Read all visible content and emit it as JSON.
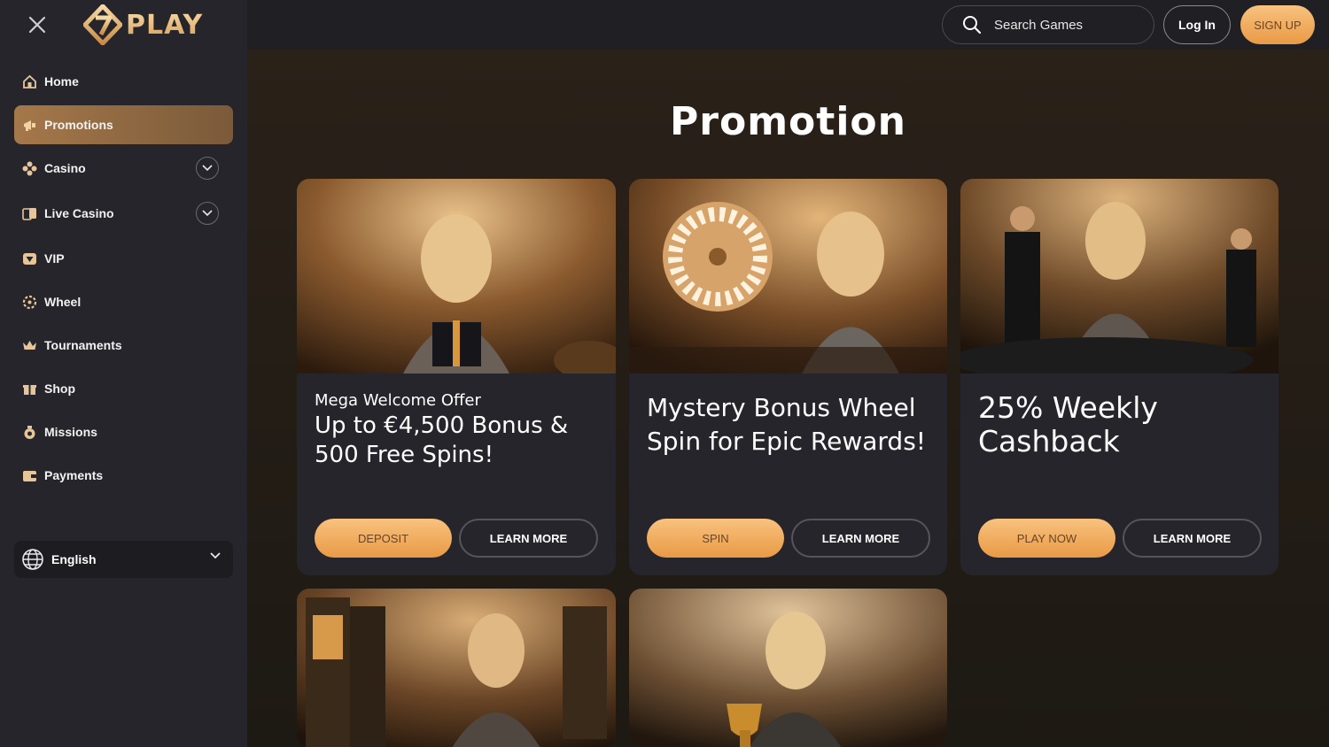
{
  "brand": {
    "logo_text": "PLAY",
    "accent": "#e99a45"
  },
  "sidebar": {
    "items": [
      {
        "label": "Home",
        "icon": "home-icon"
      },
      {
        "label": "Promotions",
        "icon": "megaphone-icon",
        "active": true
      },
      {
        "label": "Casino",
        "icon": "cards-suit-icon",
        "expandable": true
      },
      {
        "label": "Live Casino",
        "icon": "live-cards-icon",
        "expandable": true
      },
      {
        "label": "VIP",
        "icon": "diamond-icon"
      },
      {
        "label": "Wheel",
        "icon": "wheel-icon"
      },
      {
        "label": "Tournaments",
        "icon": "crown-icon"
      },
      {
        "label": "Shop",
        "icon": "gift-icon"
      },
      {
        "label": "Missions",
        "icon": "missions-icon"
      },
      {
        "label": "Payments",
        "icon": "wallet-icon"
      }
    ],
    "language": "English"
  },
  "header": {
    "search_placeholder": "Search Games",
    "login_label": "Log In",
    "signup_label": "SIGN UP"
  },
  "main": {
    "title": "Promotion",
    "cards": [
      {
        "subtitle": "Mega Welcome Offer",
        "headline": "Up to €4,500 Bonus & 500 Free Spins!",
        "primary_label": "DEPOSIT",
        "secondary_label": "LEARN MORE"
      },
      {
        "subtitle": "",
        "headline": "Mystery Bonus Wheel Spin for Epic Rewards!",
        "primary_label": "SPIN",
        "secondary_label": "LEARN MORE"
      },
      {
        "subtitle": "",
        "headline": "25% Weekly Cashback",
        "primary_label": "PLAY NOW",
        "secondary_label": "LEARN MORE"
      }
    ]
  }
}
